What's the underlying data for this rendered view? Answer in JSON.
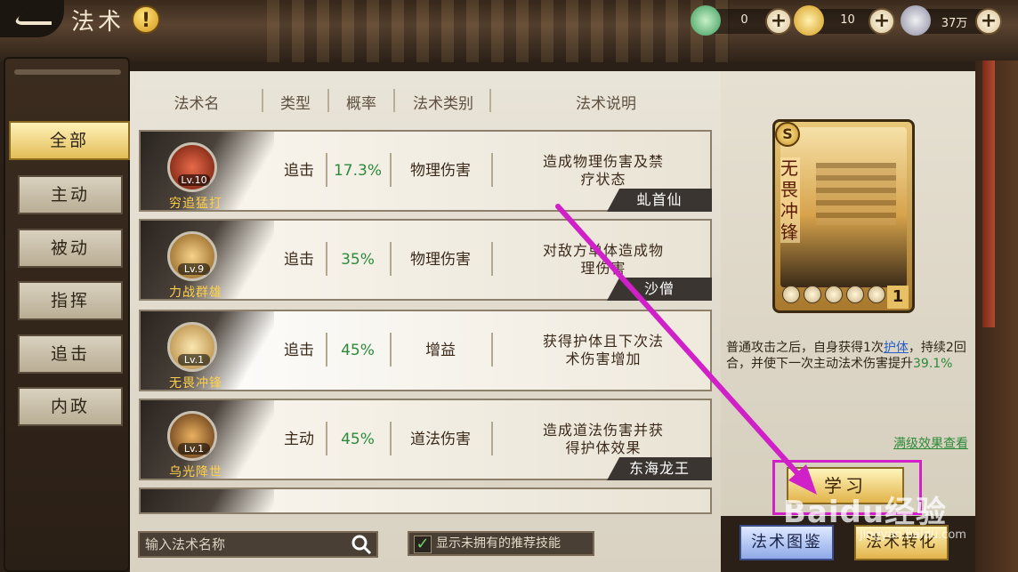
{
  "header": {
    "title": "法术",
    "help_icon_glyph": "!",
    "currencies": [
      {
        "icon": "jade-coin-icon",
        "amount": "0"
      },
      {
        "icon": "gold-ingot-icon",
        "amount": "10"
      },
      {
        "icon": "silver-ingot-icon",
        "amount": "37万"
      }
    ]
  },
  "tabs": [
    {
      "label": "全部",
      "active": true
    },
    {
      "label": "主动",
      "active": false
    },
    {
      "label": "被动",
      "active": false
    },
    {
      "label": "指挥",
      "active": false
    },
    {
      "label": "追击",
      "active": false
    },
    {
      "label": "内政",
      "active": false
    }
  ],
  "table": {
    "columns": [
      "法术名",
      "类型",
      "概率",
      "法术类别",
      "法术说明"
    ],
    "rows": [
      {
        "name": "穷追猛打",
        "level": "Lv.10",
        "type": "追击",
        "rate": "17.3%",
        "category": "物理伤害",
        "desc_line1": "造成物理伤害及禁",
        "desc_line2": "疗状态",
        "owner": "虬首仙",
        "portrait_color": "#9a2a1a"
      },
      {
        "name": "力战群雄",
        "level": "Lv.9",
        "type": "追击",
        "rate": "35%",
        "category": "物理伤害",
        "desc_line1": "对敌方单体造成物",
        "desc_line2": "理伤害",
        "owner": "沙僧",
        "portrait_color": "#c08a3a"
      },
      {
        "name": "无畏冲锋",
        "level": "Lv.1",
        "type": "追击",
        "rate": "45%",
        "category": "增益",
        "desc_line1": "获得护体且下次法",
        "desc_line2": "术伤害增加",
        "owner": "",
        "portrait_color": "#d8b060"
      },
      {
        "name": "乌光降世",
        "level": "Lv.1",
        "type": "主动",
        "rate": "45%",
        "category": "道法伤害",
        "desc_line1": "造成道法伤害并获",
        "desc_line2": "得护体效果",
        "owner": "东海龙王",
        "portrait_color": "#a06a2a"
      }
    ]
  },
  "search": {
    "placeholder": "输入法术名称"
  },
  "filter": {
    "label": "显示未拥有的推荐技能",
    "checked": true
  },
  "detail": {
    "card_rank": "S",
    "card_name": "无畏冲锋",
    "card_count": "1",
    "desc_part1": "普通攻击之后，自身获得1次",
    "desc_keyword": "护体",
    "desc_part2": "，持续2回合，并使下一次主动法术伤害提升",
    "desc_percent": "39.1%",
    "full_effect_link": "满级效果查看",
    "learn_button": "学习"
  },
  "bottom_buttons": {
    "atlas": "法术图鉴",
    "convert": "法术转化"
  },
  "watermark": {
    "brand": "Baidu经验",
    "url": "jingyan.baidu.com"
  },
  "colors": {
    "accent_gold": "#e2b44a",
    "rate_green": "#2d8a3a",
    "highlight_magenta": "#d020c8"
  }
}
